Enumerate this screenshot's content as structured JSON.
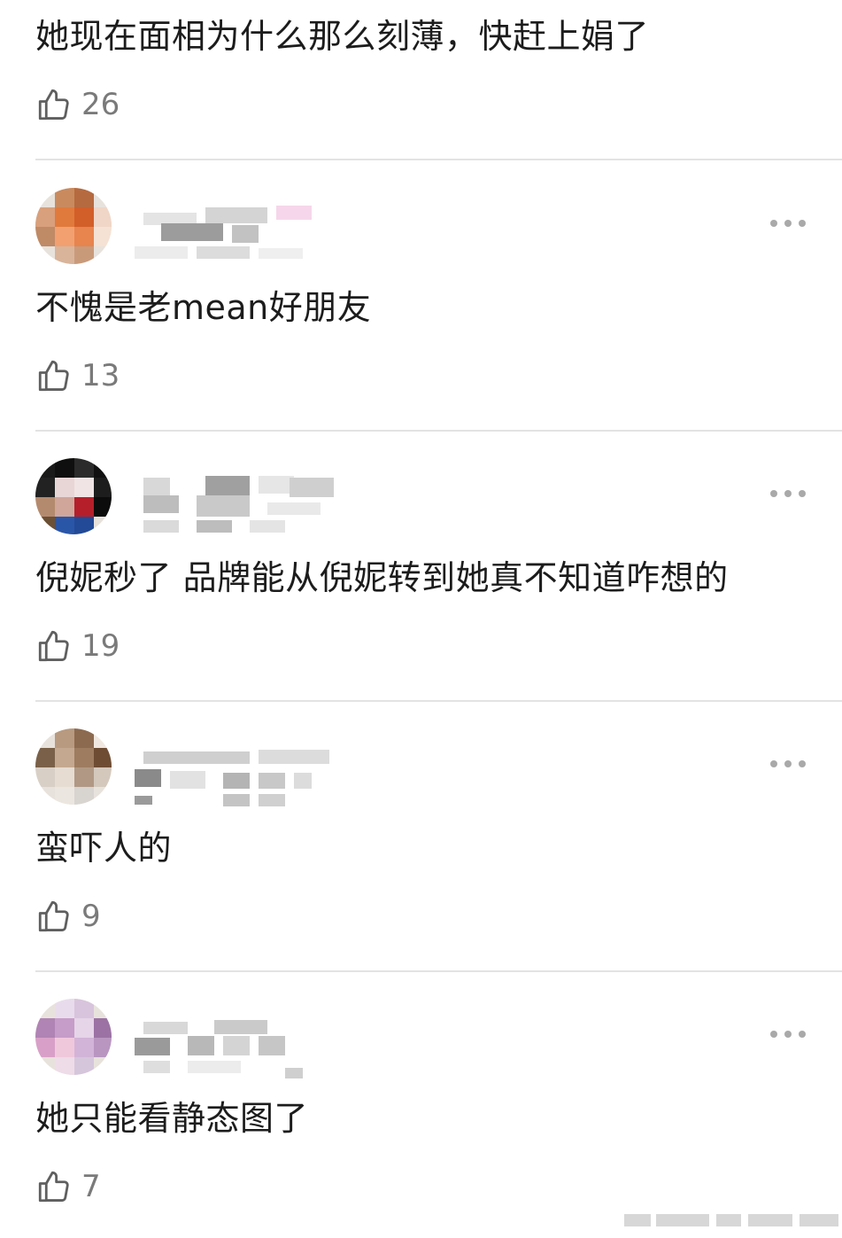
{
  "comments": [
    {
      "text": "她现在面相为什么那么刻薄，快赶上娟了",
      "likes": "26"
    },
    {
      "text": "不愧是老mean好朋友",
      "likes": "13"
    },
    {
      "text": "倪妮秒了 品牌能从倪妮转到她真不知道咋想的",
      "likes": "19"
    },
    {
      "text": "蛮吓人的",
      "likes": "9"
    },
    {
      "text": "她只能看静态图了",
      "likes": "7"
    }
  ],
  "icons": {
    "like": "thumbs-up-icon",
    "more": "more-horizontal-icon"
  },
  "colors": {
    "text": "#1c1c1c",
    "like_count": "#7a7a7a",
    "divider": "#e3e3e3",
    "dots": "#a9a9a9"
  }
}
